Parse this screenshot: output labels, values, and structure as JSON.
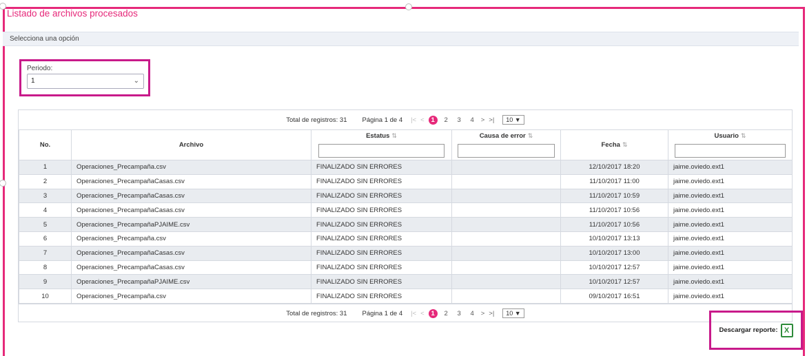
{
  "header": {
    "title": "Listado de archivos procesados",
    "subtitle": "Selecciona una opción"
  },
  "filters": {
    "periodo_label": "Periodo:",
    "periodo_value": "1"
  },
  "pager": {
    "total": "Total de registros: 31",
    "page_info": "Página 1 de 4",
    "first": "|<",
    "prev": "<",
    "pages": [
      "1",
      "2",
      "3",
      "4"
    ],
    "next": ">",
    "last": ">|",
    "rows_per_page": "10 ▼"
  },
  "table": {
    "columns": [
      {
        "label": "No.",
        "sortable": false
      },
      {
        "label": "Archivo",
        "sortable": false
      },
      {
        "label": "Estatus",
        "sortable": true
      },
      {
        "label": "Causa de error",
        "sortable": true
      },
      {
        "label": "Fecha",
        "sortable": true
      },
      {
        "label": "Usuario",
        "sortable": true
      }
    ],
    "rows": [
      [
        "1",
        "Operaciones_Precampaña.csv",
        "FINALIZADO SIN ERRORES",
        "",
        "12/10/2017 18:20",
        "jaime.oviedo.ext1"
      ],
      [
        "2",
        "Operaciones_PrecampañaCasas.csv",
        "FINALIZADO SIN ERRORES",
        "",
        "11/10/2017 11:00",
        "jaime.oviedo.ext1"
      ],
      [
        "3",
        "Operaciones_PrecampañaCasas.csv",
        "FINALIZADO SIN ERRORES",
        "",
        "11/10/2017 10:59",
        "jaime.oviedo.ext1"
      ],
      [
        "4",
        "Operaciones_PrecampañaCasas.csv",
        "FINALIZADO SIN ERRORES",
        "",
        "11/10/2017 10:56",
        "jaime.oviedo.ext1"
      ],
      [
        "5",
        "Operaciones_PrecampañaPJAIME.csv",
        "FINALIZADO SIN ERRORES",
        "",
        "11/10/2017 10:56",
        "jaime.oviedo.ext1"
      ],
      [
        "6",
        "Operaciones_Precampaña.csv",
        "FINALIZADO SIN ERRORES",
        "",
        "10/10/2017 13:13",
        "jaime.oviedo.ext1"
      ],
      [
        "7",
        "Operaciones_PrecampañaCasas.csv",
        "FINALIZADO SIN ERRORES",
        "",
        "10/10/2017 13:00",
        "jaime.oviedo.ext1"
      ],
      [
        "8",
        "Operaciones_PrecampañaCasas.csv",
        "FINALIZADO SIN ERRORES",
        "",
        "10/10/2017 12:57",
        "jaime.oviedo.ext1"
      ],
      [
        "9",
        "Operaciones_PrecampañaPJAIME.csv",
        "FINALIZADO SIN ERRORES",
        "",
        "10/10/2017 12:57",
        "jaime.oviedo.ext1"
      ],
      [
        "10",
        "Operaciones_Precampaña.csv",
        "FINALIZADO SIN ERRORES",
        "",
        "09/10/2017 16:51",
        "jaime.oviedo.ext1"
      ]
    ]
  },
  "download": {
    "label": "Descargar reporte:",
    "icon": "excel-icon"
  },
  "colors": {
    "accent": "#e6297a",
    "highlight": "#c81a8a",
    "row_stripe": "#e9ecf0"
  }
}
